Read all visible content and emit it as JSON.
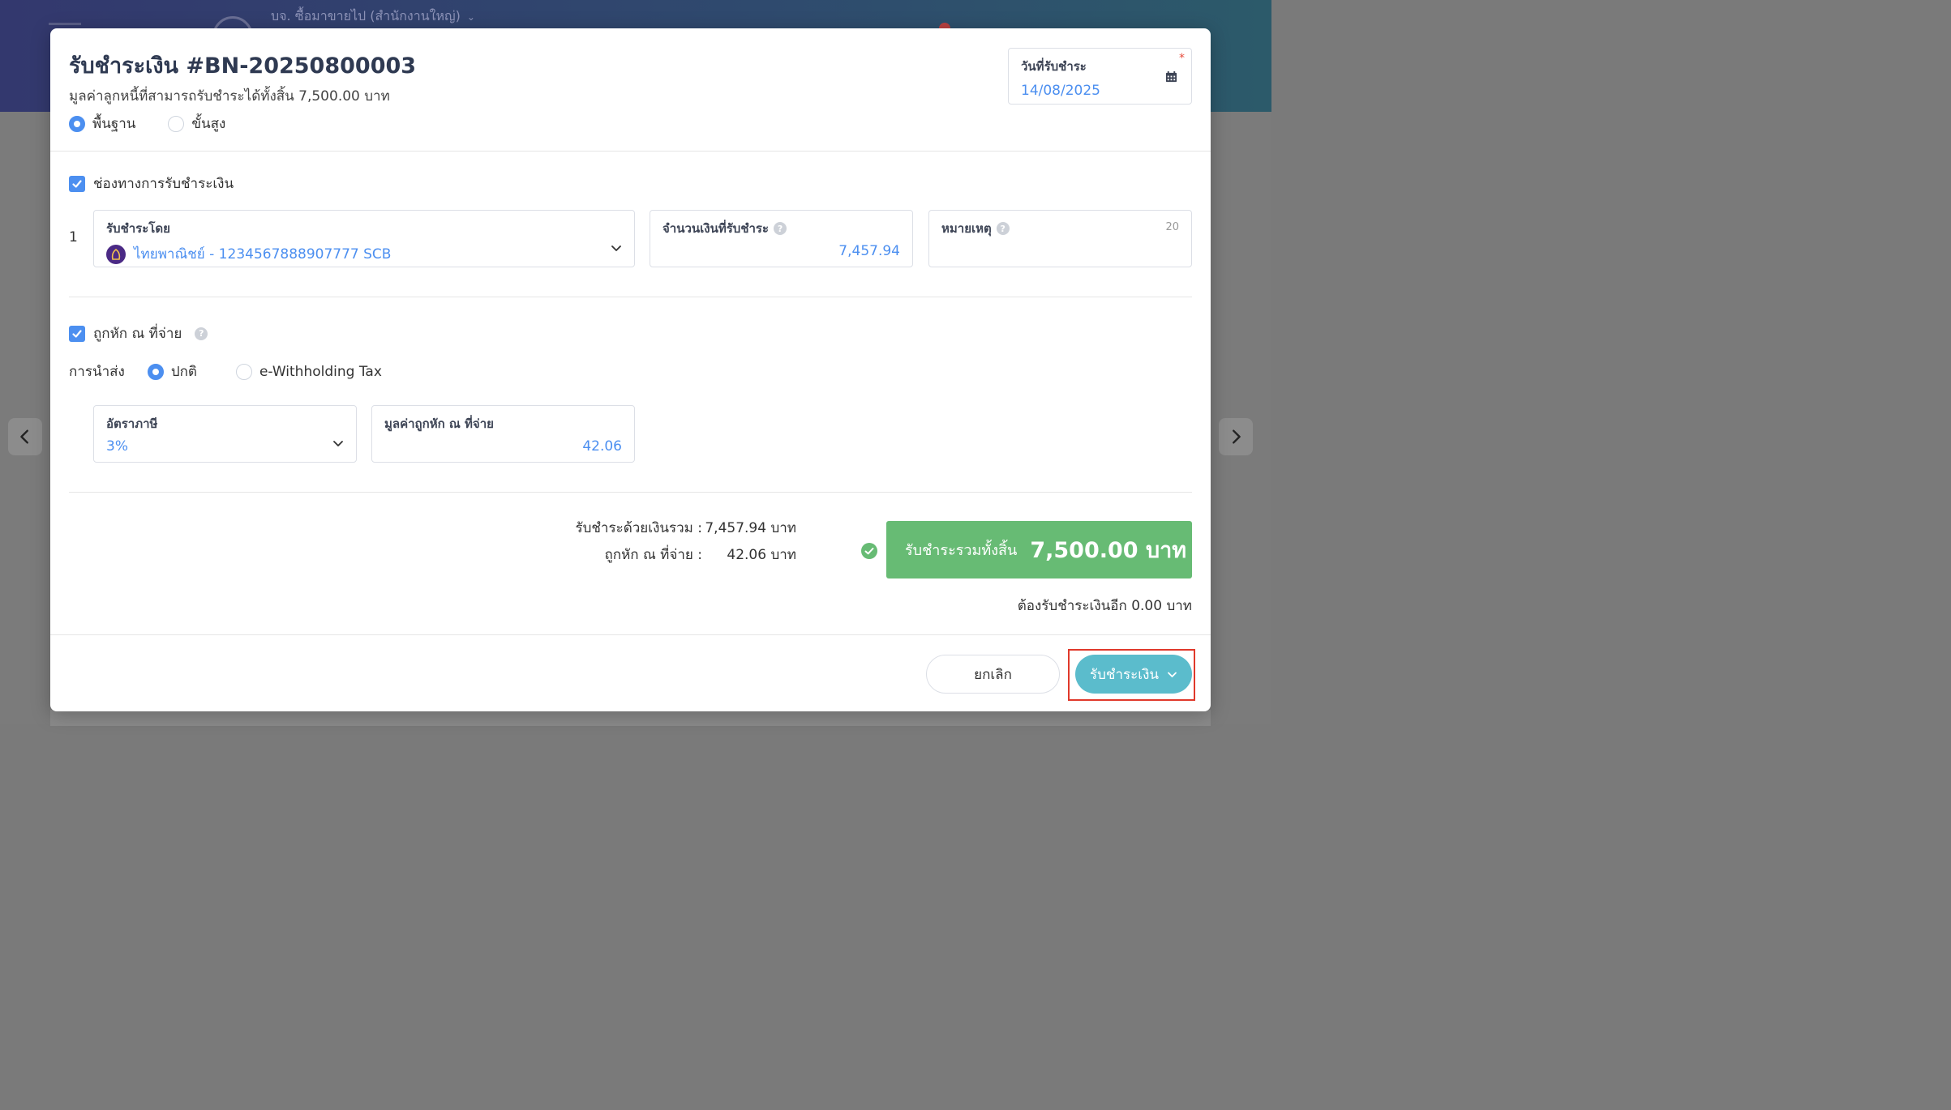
{
  "background": {
    "company_name": "บจ. ซื้อมาขายไป (สำนักงานใหญ่)"
  },
  "modal": {
    "title": "รับชำระเงิน #BN-20250800003",
    "subtitle": "มูลค่าลูกหนี้ที่สามารถรับชำระได้ทั้งสิ้น 7,500.00 บาท",
    "mode_options": [
      {
        "label": "พื้นฐาน",
        "selected": true
      },
      {
        "label": "ขั้นสูง",
        "selected": false
      }
    ],
    "payment_date": {
      "label": "วันที่รับชำระ",
      "value": "14/08/2025",
      "required_mark": "*"
    }
  },
  "payment_channel": {
    "label": "ช่องทางการรับชำระเงิน",
    "checked": true,
    "rows": [
      {
        "index": "1",
        "pay_by_label": "รับชำระโดย",
        "pay_by_value": "ไทยพาณิชย์ - 1234567888907777 SCB",
        "amount_label": "จำนวนเงินที่รับชำระ",
        "amount_value": "7,457.94",
        "note_label": "หมายเหตุ",
        "note_counter": "20"
      }
    ]
  },
  "withholding": {
    "label": "ถูกหัก ณ ที่จ่าย",
    "checked": true,
    "submit_label": "การนำส่ง",
    "submit_options": [
      {
        "label": "ปกติ",
        "selected": true
      },
      {
        "label": "e-Withholding Tax",
        "selected": false
      }
    ],
    "rate_label": "อัตราภาษี",
    "rate_value": "3%",
    "amount_label": "มูลค่าถูกหัก ณ ที่จ่าย",
    "amount_value": "42.06"
  },
  "summary": {
    "received_label": "รับชำระด้วยเงินรวม :",
    "received_value": "7,457.94 บาท",
    "wht_label": "ถูกหัก ณ ที่จ่าย :",
    "wht_value": "42.06 บาท",
    "total_label": "รับชำระรวมทั้งสิ้น",
    "total_value": "7,500.00 บาท",
    "remaining": "ต้องรับชำระเงินอีก 0.00 บาท"
  },
  "footer": {
    "cancel_label": "ยกเลิก",
    "receive_label": "รับชำระเงิน"
  },
  "colors": {
    "accent": "#4c8ff0",
    "success": "#67bb74",
    "primary_button": "#5bbccc",
    "highlight": "#e0392b"
  }
}
